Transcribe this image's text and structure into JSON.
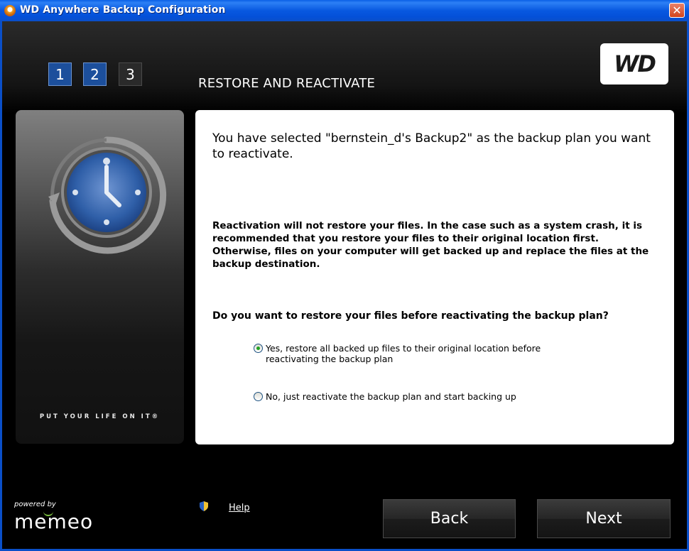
{
  "window": {
    "title": "WD Anywhere Backup Configuration",
    "close_glyph": "✕"
  },
  "steps": [
    {
      "label": "1",
      "state": "active"
    },
    {
      "label": "2",
      "state": "active"
    },
    {
      "label": "3",
      "state": "inactive"
    }
  ],
  "page_heading": "RESTORE AND REACTIVATE",
  "brand": {
    "logo_text": "WD",
    "tagline": "PUT YOUR LIFE ON IT®",
    "powered_by": "powered by",
    "vendor": "memeo"
  },
  "content": {
    "intro": "You have selected \"bernstein_d's Backup2\" as the backup plan you want to reactivate.",
    "warning": "Reactivation will not restore your files.  In the case such as a system crash, it is recommended that you restore your files to their original location first.  Otherwise, files on your computer will get backed up and replace the files at the backup destination.",
    "question": "Do you want to restore your files before reactivating the backup plan?",
    "options": [
      {
        "label": "Yes, restore all backed up files to their original location before reactivating the backup plan",
        "checked": true
      },
      {
        "label": "No, just reactivate the backup plan and start backing up",
        "checked": false
      }
    ]
  },
  "footer": {
    "help_label": "Help",
    "back_label": "Back",
    "next_label": "Next"
  },
  "colors": {
    "titlebar": "#0858e0",
    "step_active": "#1c4f9c",
    "radio_dot": "#21a121",
    "memeo_accent": "#7dc242"
  }
}
